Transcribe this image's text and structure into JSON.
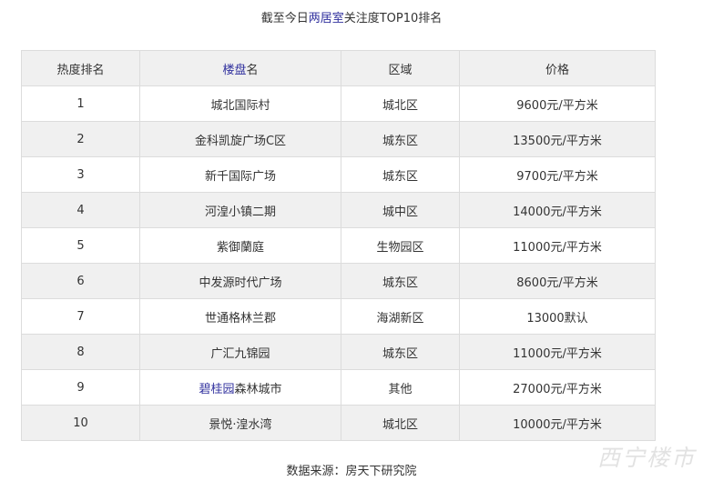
{
  "caption": {
    "prefix": "截至今日",
    "highlight": "两居室",
    "suffix": "关注度TOP10排名"
  },
  "table": {
    "headers": {
      "rank": "热度排名",
      "name_highlight": "楼盘",
      "name_rest": "名",
      "district": "区域",
      "price": "价格"
    },
    "rows": [
      {
        "rank": "1",
        "name_hl": "",
        "name": "城北国际村",
        "district": "城北区",
        "price": "9600元/平方米"
      },
      {
        "rank": "2",
        "name_hl": "",
        "name": "金科凯旋广场C区",
        "district": "城东区",
        "price": "13500元/平方米"
      },
      {
        "rank": "3",
        "name_hl": "",
        "name": "新千国际广场",
        "district": "城东区",
        "price": "9700元/平方米"
      },
      {
        "rank": "4",
        "name_hl": "",
        "name": "河湟小镇二期",
        "district": "城中区",
        "price": "14000元/平方米"
      },
      {
        "rank": "5",
        "name_hl": "",
        "name": "紫御蘭庭",
        "district": "生物园区",
        "price": "11000元/平方米"
      },
      {
        "rank": "6",
        "name_hl": "",
        "name": "中发源时代广场",
        "district": "城东区",
        "price": "8600元/平方米"
      },
      {
        "rank": "7",
        "name_hl": "",
        "name": "世通格林兰郡",
        "district": "海湖新区",
        "price": "13000默认"
      },
      {
        "rank": "8",
        "name_hl": "",
        "name": "广汇九锦园",
        "district": "城东区",
        "price": "11000元/平方米"
      },
      {
        "rank": "9",
        "name_hl": "碧桂园",
        "name": "森林城市",
        "district": "其他",
        "price": "27000元/平方米"
      },
      {
        "rank": "10",
        "name_hl": "",
        "name": "景悦·湟水湾",
        "district": "城北区",
        "price": "10000元/平方米"
      }
    ]
  },
  "source": "数据来源：房天下研究院",
  "watermark": "西宁楼市",
  "colors": {
    "highlight_text": "#2f2f9d",
    "header_bg": "#f0f0f0",
    "stripe_bg": "#f0f0f0",
    "border": "#dcdcdc"
  }
}
